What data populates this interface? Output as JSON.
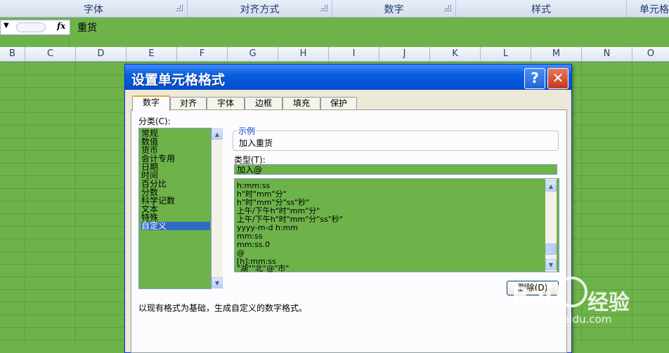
{
  "ribbon": {
    "groups": [
      "字体",
      "对齐方式",
      "数字",
      "样式",
      "单元格"
    ]
  },
  "formula_bar": {
    "fx_label": "fx",
    "value": "重货"
  },
  "columns": [
    "B",
    "C",
    "D",
    "E",
    "F",
    "G",
    "H",
    "I",
    "J",
    "K",
    "L",
    "M",
    "N",
    "O"
  ],
  "dialog": {
    "title": "设置单元格格式",
    "help_glyph": "?",
    "close_glyph": "✕",
    "tabs": [
      "数字",
      "对齐",
      "字体",
      "边框",
      "填充",
      "保护"
    ],
    "active_tab": "数字",
    "category_label": "分类(C):",
    "categories": [
      "常规",
      "数值",
      "货币",
      "会计专用",
      "日期",
      "时间",
      "百分比",
      "分数",
      "科学记数",
      "文本",
      "特殊",
      "自定义"
    ],
    "selected_category": "自定义",
    "sample_label": "示例",
    "sample_value": "加入重货",
    "type_label": "类型(T):",
    "type_value": "加入@",
    "formats": [
      "h:mm:ss",
      "h\"时\"mm\"分\"",
      "h\"时\"mm\"分\"ss\"秒\"",
      "上午/下午h\"时\"mm\"分\"",
      "上午/下午h\"时\"mm\"分\"ss\"秒\"",
      "yyyy-m-d h:mm",
      "mm:ss",
      "mm:ss.0",
      "@",
      "[h]:mm:ss",
      "\"湖\"\"北\"@\"市\""
    ],
    "delete_button": "删除(D)",
    "description": "以现有格式为基础，生成自定义的数字格式。"
  },
  "watermark": {
    "brand": "Bai",
    "brand_cn": "经验",
    "url": "jingyan.baidu.com"
  }
}
